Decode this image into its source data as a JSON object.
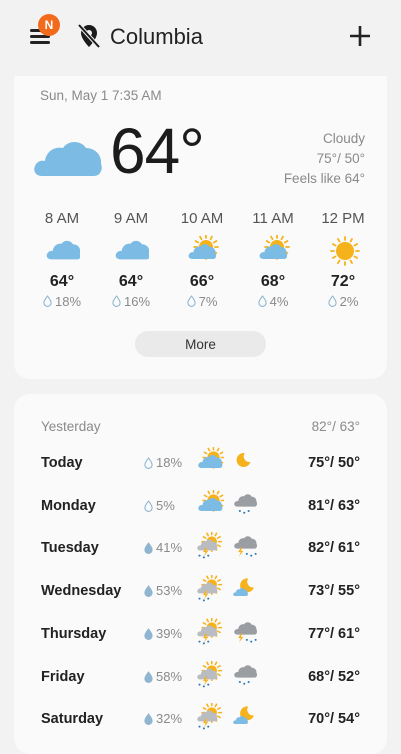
{
  "header": {
    "badge": "N",
    "city": "Columbia"
  },
  "current": {
    "datetime": "Sun, May 1 7:35 AM",
    "temp": "64°",
    "condition": "Cloudy",
    "high_low": "75°/ 50°",
    "feels_like": "Feels like 64°",
    "icon": "cloudy-icon"
  },
  "hourly": [
    {
      "time": "8 AM",
      "temp": "64°",
      "precip": "18%",
      "icon": "cloudy-icon"
    },
    {
      "time": "9 AM",
      "temp": "64°",
      "precip": "16%",
      "icon": "cloudy-icon"
    },
    {
      "time": "10 AM",
      "temp": "66°",
      "precip": "7%",
      "icon": "partly-sunny-icon"
    },
    {
      "time": "11 AM",
      "temp": "68°",
      "precip": "4%",
      "icon": "partly-sunny-icon"
    },
    {
      "time": "12 PM",
      "temp": "72°",
      "precip": "2%",
      "icon": "sunny-icon"
    }
  ],
  "more_label": "More",
  "daily": {
    "yesterday_label": "Yesterday",
    "yesterday_hl": "82°/ 63°",
    "days": [
      {
        "name": "Today",
        "precip": "18%",
        "high_low": "75°/ 50°",
        "day_icon": "partly-sunny-icon",
        "night_icon": "moon-icon"
      },
      {
        "name": "Monday",
        "precip": "5%",
        "high_low": "81°/ 63°",
        "day_icon": "partly-sunny-icon",
        "night_icon": "cloud-rain-icon"
      },
      {
        "name": "Tuesday",
        "precip": "41%",
        "high_low": "82°/ 61°",
        "day_icon": "sun-thunder-icon",
        "night_icon": "cloud-thunder-icon"
      },
      {
        "name": "Wednesday",
        "precip": "53%",
        "high_low": "73°/ 55°",
        "day_icon": "sun-thunder-icon",
        "night_icon": "moon-cloud-icon"
      },
      {
        "name": "Thursday",
        "precip": "39%",
        "high_low": "77°/ 61°",
        "day_icon": "sun-thunder-icon",
        "night_icon": "cloud-thunder-icon"
      },
      {
        "name": "Friday",
        "precip": "58%",
        "high_low": "68°/ 52°",
        "day_icon": "sun-thunder-icon",
        "night_icon": "cloud-rain-icon"
      },
      {
        "name": "Saturday",
        "precip": "32%",
        "high_low": "70°/ 54°",
        "day_icon": "sun-thunder-icon",
        "night_icon": "moon-cloud-icon"
      }
    ]
  },
  "colors": {
    "badge": "#f26b1d",
    "cloud": "#7cbbe3",
    "sun": "#f6b21a",
    "drop": "#8fb5d0"
  }
}
